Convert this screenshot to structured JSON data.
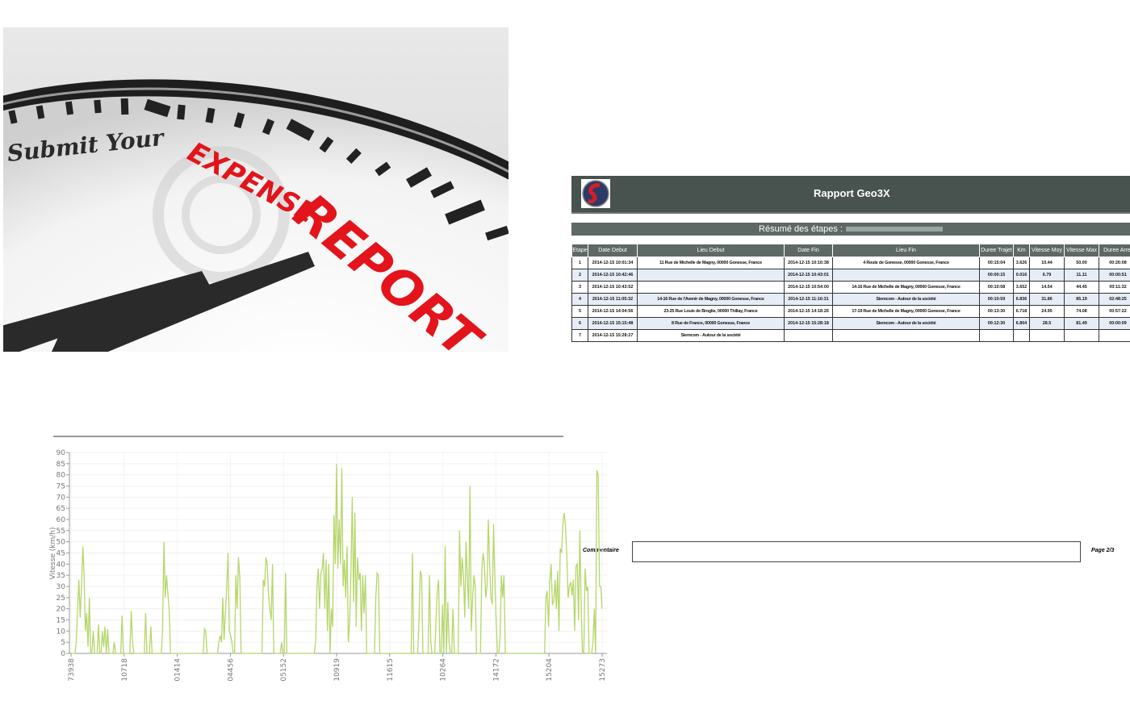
{
  "illustration": {
    "dial_text": "Submit Your",
    "headline_line1": "EXPENSE",
    "headline_line2": "REPORT"
  },
  "report": {
    "title": "Rapport Geo3X",
    "summary_label": "Résumé des étapes :",
    "columns": [
      "Etape",
      "Date Debut",
      "Lieu Debut",
      "Date Fin",
      "Lieu Fin",
      "Duree Trajet",
      "Km",
      "Vitesse Moy",
      "Vitesse Max",
      "Duree Arret"
    ],
    "rows": [
      {
        "etape": "1",
        "date_debut": "2014-12-15 10:01:34",
        "lieu_debut": "11 Rue de Michelle de Magny, 00000 Gonesse, France",
        "date_fin": "2014-12-15 10:16:38",
        "lieu_fin": "4 Route de Gonesse, 00000 Gonesse, France",
        "duree": "00:15:04",
        "km": "3.626",
        "vmoy": "10.44",
        "vmax": "50.00",
        "arret": "00:26:08"
      },
      {
        "etape": "2",
        "date_debut": "2014-12-15 10:42:46",
        "lieu_debut": "",
        "date_fin": "2014-12-15 10:43:01",
        "lieu_fin": "",
        "duree": "00:00:15",
        "km": "0.016",
        "vmoy": "6.79",
        "vmax": "11.11",
        "arret": "00:00:51"
      },
      {
        "etape": "3",
        "date_debut": "2014-12-15 10:43:52",
        "lieu_debut": "",
        "date_fin": "2014-12-15 10:54:00",
        "lieu_fin": "14-16 Rue de Michelle de Magny, 00000 Gonesse, France",
        "duree": "00:10:08",
        "km": "3.652",
        "vmoy": "14.54",
        "vmax": "44.45",
        "arret": "00:11:32"
      },
      {
        "etape": "4",
        "date_debut": "2014-12-15 11:05:32",
        "lieu_debut": "14-16 Rue de l'Avenir de Magny, 00000 Gonesse, France",
        "date_fin": "2014-12-15 11:16:31",
        "lieu_fin": "Siemcom - Autour de la société",
        "duree": "00:10:59",
        "km": "6.836",
        "vmoy": "31.86",
        "vmax": "85.19",
        "arret": "02:48:25"
      },
      {
        "etape": "5",
        "date_debut": "2014-12-15 14:04:56",
        "lieu_debut": "23-25 Rue Louis de Broglie, 00000 Thillay, France",
        "date_fin": "2014-12-15 14:18:26",
        "lieu_fin": "17-19 Rue de Michelle de Magny, 00000 Gonesse, France",
        "duree": "00:13:30",
        "km": "6.718",
        "vmoy": "24.95",
        "vmax": "74.08",
        "arret": "00:57:22"
      },
      {
        "etape": "6",
        "date_debut": "2014-12-15 15:15:48",
        "lieu_debut": "8 Rue de France, 00000 Gonesse, France",
        "date_fin": "2014-12-15 15:28:18",
        "lieu_fin": "Siemcom - Autour de la société",
        "duree": "00:12:30",
        "km": "6.804",
        "vmoy": "28.5",
        "vmax": "81.49",
        "arret": "00:00:09"
      },
      {
        "etape": "7",
        "date_debut": "2014-12-15 15:28:27",
        "lieu_debut": "Siemcom - Autour de la société",
        "date_fin": "",
        "lieu_fin": "",
        "duree": "",
        "km": "",
        "vmoy": "",
        "vmax": "",
        "arret": ""
      }
    ],
    "comment_label": "Commentaire",
    "page_label": "Page 2/3"
  },
  "chart_data": {
    "type": "line",
    "ylabel": "Vitesse (km/h)",
    "xlabel": "",
    "ylim": [
      0,
      90
    ],
    "yticks": [
      0,
      5,
      10,
      15,
      20,
      25,
      30,
      35,
      40,
      45,
      50,
      55,
      60,
      65,
      70,
      75,
      80,
      85,
      90
    ],
    "xtick_labels": [
      "73938",
      "10718",
      "01414",
      "04456",
      "05152",
      "10919",
      "11615",
      "10264",
      "14172",
      "15204",
      "15273"
    ],
    "grid": true,
    "color": "#b5d66a",
    "series": [
      {
        "values": [
          0,
          0,
          0,
          0,
          5,
          20,
          33,
          16,
          30,
          48,
          35,
          10,
          18,
          3,
          25,
          0,
          0,
          10,
          0,
          0,
          0,
          13,
          0,
          0,
          10,
          3,
          12,
          0,
          11,
          0,
          0,
          0,
          0,
          5,
          0,
          0,
          0,
          0,
          0,
          17,
          0,
          0,
          0,
          0,
          0,
          0,
          19,
          5,
          0,
          0,
          0,
          0,
          0,
          0,
          0,
          0,
          0,
          18,
          0,
          0,
          0,
          12,
          0,
          0,
          0,
          0,
          0,
          0,
          0,
          0,
          10,
          50,
          25,
          35,
          27,
          20,
          0,
          0,
          0,
          0,
          0,
          0,
          0,
          0,
          0,
          0,
          0,
          0,
          0,
          0,
          0,
          0,
          0,
          0,
          0,
          0,
          0,
          0,
          0,
          0,
          0,
          0,
          11,
          10,
          0,
          0,
          0,
          0,
          0,
          0,
          0,
          0,
          0,
          5,
          8,
          5,
          25,
          6,
          18,
          30,
          45,
          10,
          8,
          5,
          0,
          0,
          35,
          20,
          43,
          34,
          0,
          0,
          0,
          0,
          0,
          0,
          0,
          0,
          0,
          0,
          0,
          0,
          0,
          0,
          0,
          0,
          0,
          33,
          30,
          43,
          40,
          26,
          20,
          15,
          40,
          0,
          0,
          0,
          0,
          0,
          0,
          5,
          0,
          0,
          36,
          0,
          0,
          0,
          0,
          0,
          0,
          0,
          0,
          0,
          0,
          0,
          0,
          0,
          0,
          0,
          0,
          0,
          0,
          0,
          0,
          0,
          0,
          5,
          30,
          38,
          20,
          36,
          38,
          45,
          20,
          42,
          10,
          40,
          0,
          20,
          12,
          62,
          40,
          85,
          38,
          60,
          40,
          83,
          30,
          42,
          25,
          48,
          5,
          14,
          36,
          70,
          23,
          63,
          12,
          43,
          33,
          36,
          10,
          35,
          18,
          35,
          0,
          0,
          0,
          0,
          0,
          0,
          0,
          25,
          36,
          35,
          0,
          0,
          0,
          0,
          0,
          0,
          0,
          0,
          0,
          0,
          0,
          0,
          0,
          0,
          0,
          0,
          0,
          0,
          0,
          0,
          0,
          0,
          0,
          0,
          0,
          45,
          0,
          0,
          0,
          0,
          15,
          37,
          35,
          0,
          0,
          0,
          0,
          0,
          35,
          5,
          0,
          0,
          0,
          15,
          28,
          33,
          0,
          0,
          22,
          0,
          48,
          0,
          23,
          5,
          0,
          0,
          20,
          0,
          0,
          0,
          0,
          55,
          30,
          43,
          35,
          16,
          50,
          33,
          20,
          75,
          10,
          25,
          35,
          30,
          0,
          0,
          0,
          0,
          37,
          45,
          40,
          25,
          30,
          60,
          40,
          25,
          22,
          58,
          33,
          15,
          0,
          0,
          8,
          35,
          25,
          35,
          0,
          0,
          0,
          0,
          0,
          0,
          0,
          0,
          0,
          0,
          0,
          0,
          0,
          0,
          0,
          0,
          0,
          0,
          0,
          0,
          0,
          0,
          0,
          0,
          0,
          0,
          0,
          0,
          0,
          0,
          0,
          25,
          28,
          12,
          33,
          40,
          22,
          23,
          33,
          20,
          37,
          10,
          47,
          45,
          58,
          63,
          57,
          44,
          25,
          30,
          32,
          26,
          33,
          10,
          39,
          40,
          15,
          55,
          20,
          0,
          0,
          38,
          28,
          30,
          0,
          0,
          0,
          5,
          20,
          0,
          82,
          80,
          30,
          30,
          20
        ]
      }
    ]
  }
}
